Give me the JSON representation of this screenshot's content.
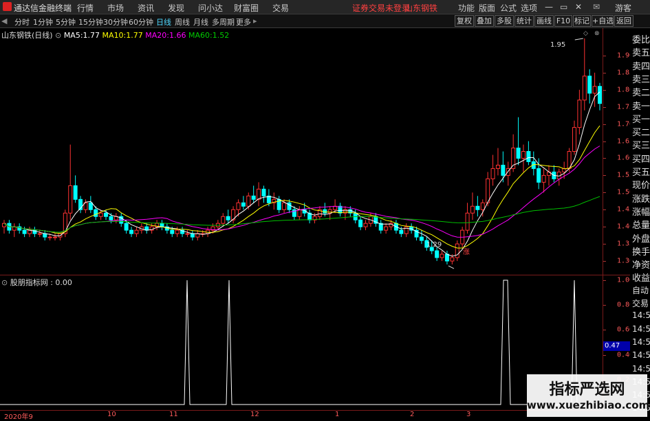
{
  "app": {
    "title": "通达信金融终端",
    "menu": [
      "行情",
      "市场",
      "资讯",
      "发现",
      "问小达",
      "财富圈",
      "交易"
    ],
    "broker_status": "证券交易未登录",
    "stock_title": "山东钢铁",
    "right_menu": [
      "功能",
      "版面",
      "公式",
      "选项"
    ],
    "user": "游客",
    "icon_names": [
      "app-logo-icon",
      "minimize-icon",
      "maximize-icon",
      "close-icon",
      "notification-icon",
      "back-arrow-icon",
      "forward-arrow-icon"
    ]
  },
  "toolbar": {
    "periods": [
      "分时",
      "1分钟",
      "5分钟",
      "15分钟",
      "30分钟",
      "60分钟",
      "日线",
      "周线",
      "月线",
      "多周期",
      "更多"
    ],
    "active": "日线",
    "buttons": [
      "复权",
      "叠加",
      "多股",
      "统计",
      "画线",
      "F10",
      "标记",
      "+自选",
      "返回"
    ]
  },
  "chart": {
    "title": "山东钢铁(日线)",
    "ma": [
      {
        "label": "MA5:",
        "value": "1.77",
        "color": "#ffffff"
      },
      {
        "label": "MA10:",
        "value": "1.77",
        "color": "#ffff00"
      },
      {
        "label": "MA20:",
        "value": "1.66",
        "color": "#ff00ff"
      },
      {
        "label": "MA60:",
        "value": "1.52",
        "color": "#00c000"
      }
    ],
    "high_label": "1.95",
    "low_label": "1.29",
    "zhang_label": "涨",
    "y_ticks": [
      "1.90",
      "1.85",
      "1.80",
      "1.75",
      "1.70",
      "1.65",
      "1.60",
      "1.55",
      "1.50",
      "1.45",
      "1.40",
      "1.35",
      "1.30"
    ]
  },
  "indicator": {
    "title": "股朋指标网 : 0.00",
    "y_ticks": [
      "1.00",
      "0.80",
      "0.60",
      "0.40",
      "0.20"
    ],
    "current": "0.47"
  },
  "xaxis": {
    "labels": [
      "2020年9",
      "10",
      "11",
      "12",
      "1",
      "2",
      "3"
    ]
  },
  "side_panel": {
    "labels": [
      "委比",
      "卖五",
      "卖四",
      "卖三",
      "卖二",
      "卖一",
      "买一",
      "买二",
      "买三",
      "买四",
      "买五",
      "现价",
      "涨跌",
      "涨幅",
      "总量",
      "外盘",
      "换手",
      "净资",
      "收益",
      "自动",
      "交易",
      "14:54",
      "14:54",
      "14:54",
      "14:54",
      "14:54",
      "14:55",
      "14:55",
      "14:55"
    ]
  },
  "watermark": {
    "line1": "指标严选网",
    "line2": "www.xuezhibiao.com"
  },
  "chart_data": {
    "type": "candlestick",
    "title": "山东钢铁(日线)",
    "ylim": [
      1.26,
      1.98
    ],
    "annotations": {
      "high": 1.95,
      "low": 1.29
    },
    "indicator": {
      "name": "股朋指标网",
      "value": 0.0,
      "ylim": [
        0,
        1.0
      ],
      "spike_dates": [
        "11-16",
        "12-01",
        "03-18",
        "03-31"
      ]
    },
    "x_labels": [
      "2020年9",
      "10",
      "11",
      "12",
      "1",
      "2",
      "3"
    ],
    "ohlc": [
      [
        1.4,
        1.42,
        1.38,
        1.41
      ],
      [
        1.41,
        1.42,
        1.38,
        1.39
      ],
      [
        1.39,
        1.41,
        1.37,
        1.4
      ],
      [
        1.4,
        1.41,
        1.38,
        1.39
      ],
      [
        1.39,
        1.4,
        1.37,
        1.38
      ],
      [
        1.38,
        1.4,
        1.37,
        1.39
      ],
      [
        1.39,
        1.4,
        1.37,
        1.38
      ],
      [
        1.38,
        1.39,
        1.37,
        1.38
      ],
      [
        1.38,
        1.39,
        1.36,
        1.37
      ],
      [
        1.37,
        1.38,
        1.36,
        1.37
      ],
      [
        1.37,
        1.38,
        1.36,
        1.37
      ],
      [
        1.37,
        1.38,
        1.36,
        1.38
      ],
      [
        1.38,
        1.45,
        1.37,
        1.44
      ],
      [
        1.44,
        1.64,
        1.42,
        1.52
      ],
      [
        1.52,
        1.55,
        1.47,
        1.48
      ],
      [
        1.48,
        1.49,
        1.44,
        1.45
      ],
      [
        1.45,
        1.48,
        1.44,
        1.47
      ],
      [
        1.47,
        1.49,
        1.44,
        1.45
      ],
      [
        1.45,
        1.46,
        1.42,
        1.43
      ],
      [
        1.43,
        1.45,
        1.42,
        1.44
      ],
      [
        1.44,
        1.45,
        1.42,
        1.43
      ],
      [
        1.43,
        1.44,
        1.41,
        1.42
      ],
      [
        1.42,
        1.44,
        1.41,
        1.43
      ],
      [
        1.43,
        1.44,
        1.4,
        1.41
      ],
      [
        1.41,
        1.42,
        1.38,
        1.39
      ],
      [
        1.39,
        1.4,
        1.37,
        1.38
      ],
      [
        1.38,
        1.4,
        1.37,
        1.39
      ],
      [
        1.39,
        1.41,
        1.38,
        1.4
      ],
      [
        1.4,
        1.41,
        1.38,
        1.39
      ],
      [
        1.39,
        1.41,
        1.38,
        1.4
      ],
      [
        1.4,
        1.42,
        1.39,
        1.41
      ],
      [
        1.41,
        1.42,
        1.39,
        1.4
      ],
      [
        1.4,
        1.41,
        1.38,
        1.39
      ],
      [
        1.39,
        1.4,
        1.37,
        1.38
      ],
      [
        1.38,
        1.4,
        1.37,
        1.39
      ],
      [
        1.39,
        1.4,
        1.37,
        1.38
      ],
      [
        1.38,
        1.39,
        1.37,
        1.38
      ],
      [
        1.38,
        1.39,
        1.36,
        1.37
      ],
      [
        1.37,
        1.39,
        1.36,
        1.38
      ],
      [
        1.38,
        1.39,
        1.37,
        1.38
      ],
      [
        1.38,
        1.4,
        1.37,
        1.39
      ],
      [
        1.39,
        1.41,
        1.38,
        1.4
      ],
      [
        1.4,
        1.42,
        1.39,
        1.41
      ],
      [
        1.41,
        1.44,
        1.4,
        1.43
      ],
      [
        1.43,
        1.45,
        1.41,
        1.42
      ],
      [
        1.42,
        1.46,
        1.41,
        1.45
      ],
      [
        1.45,
        1.48,
        1.43,
        1.47
      ],
      [
        1.47,
        1.49,
        1.45,
        1.46
      ],
      [
        1.46,
        1.5,
        1.45,
        1.49
      ],
      [
        1.49,
        1.52,
        1.47,
        1.48
      ],
      [
        1.48,
        1.53,
        1.46,
        1.51
      ],
      [
        1.51,
        1.52,
        1.47,
        1.49
      ],
      [
        1.49,
        1.51,
        1.46,
        1.47
      ],
      [
        1.47,
        1.5,
        1.45,
        1.48
      ],
      [
        1.48,
        1.49,
        1.44,
        1.45
      ],
      [
        1.45,
        1.48,
        1.44,
        1.47
      ],
      [
        1.47,
        1.48,
        1.44,
        1.45
      ],
      [
        1.45,
        1.46,
        1.42,
        1.43
      ],
      [
        1.43,
        1.46,
        1.42,
        1.45
      ],
      [
        1.45,
        1.47,
        1.43,
        1.44
      ],
      [
        1.44,
        1.45,
        1.41,
        1.42
      ],
      [
        1.42,
        1.44,
        1.41,
        1.43
      ],
      [
        1.43,
        1.46,
        1.42,
        1.45
      ],
      [
        1.45,
        1.47,
        1.43,
        1.44
      ],
      [
        1.44,
        1.46,
        1.42,
        1.45
      ],
      [
        1.45,
        1.48,
        1.44,
        1.46
      ],
      [
        1.46,
        1.47,
        1.43,
        1.44
      ],
      [
        1.44,
        1.46,
        1.42,
        1.45
      ],
      [
        1.45,
        1.46,
        1.43,
        1.44
      ],
      [
        1.44,
        1.45,
        1.41,
        1.42
      ],
      [
        1.42,
        1.43,
        1.39,
        1.4
      ],
      [
        1.4,
        1.42,
        1.39,
        1.41
      ],
      [
        1.41,
        1.44,
        1.4,
        1.43
      ],
      [
        1.43,
        1.44,
        1.4,
        1.41
      ],
      [
        1.41,
        1.42,
        1.38,
        1.39
      ],
      [
        1.39,
        1.41,
        1.38,
        1.4
      ],
      [
        1.4,
        1.42,
        1.39,
        1.41
      ],
      [
        1.41,
        1.42,
        1.38,
        1.39
      ],
      [
        1.39,
        1.4,
        1.37,
        1.38
      ],
      [
        1.38,
        1.41,
        1.37,
        1.4
      ],
      [
        1.4,
        1.41,
        1.38,
        1.39
      ],
      [
        1.39,
        1.4,
        1.36,
        1.37
      ],
      [
        1.37,
        1.39,
        1.35,
        1.36
      ],
      [
        1.36,
        1.37,
        1.33,
        1.34
      ],
      [
        1.34,
        1.36,
        1.32,
        1.33
      ],
      [
        1.33,
        1.34,
        1.3,
        1.31
      ],
      [
        1.31,
        1.33,
        1.3,
        1.32
      ],
      [
        1.32,
        1.33,
        1.29,
        1.3
      ],
      [
        1.3,
        1.32,
        1.29,
        1.31
      ],
      [
        1.31,
        1.36,
        1.3,
        1.35
      ],
      [
        1.35,
        1.4,
        1.34,
        1.39
      ],
      [
        1.39,
        1.47,
        1.38,
        1.44
      ],
      [
        1.44,
        1.5,
        1.42,
        1.46
      ],
      [
        1.46,
        1.49,
        1.43,
        1.45
      ],
      [
        1.45,
        1.48,
        1.43,
        1.47
      ],
      [
        1.47,
        1.56,
        1.46,
        1.54
      ],
      [
        1.54,
        1.61,
        1.52,
        1.57
      ],
      [
        1.57,
        1.63,
        1.55,
        1.58
      ],
      [
        1.58,
        1.62,
        1.53,
        1.55
      ],
      [
        1.55,
        1.59,
        1.52,
        1.57
      ],
      [
        1.57,
        1.67,
        1.56,
        1.63
      ],
      [
        1.63,
        1.72,
        1.58,
        1.6
      ],
      [
        1.6,
        1.64,
        1.56,
        1.62
      ],
      [
        1.62,
        1.65,
        1.58,
        1.59
      ],
      [
        1.59,
        1.62,
        1.55,
        1.57
      ],
      [
        1.57,
        1.6,
        1.51,
        1.53
      ],
      [
        1.53,
        1.57,
        1.5,
        1.55
      ],
      [
        1.55,
        1.58,
        1.52,
        1.56
      ],
      [
        1.56,
        1.58,
        1.53,
        1.54
      ],
      [
        1.54,
        1.57,
        1.52,
        1.56
      ],
      [
        1.56,
        1.59,
        1.54,
        1.57
      ],
      [
        1.57,
        1.63,
        1.56,
        1.62
      ],
      [
        1.62,
        1.71,
        1.61,
        1.69
      ],
      [
        1.69,
        1.8,
        1.67,
        1.77
      ],
      [
        1.77,
        1.95,
        1.74,
        1.84
      ],
      [
        1.84,
        1.86,
        1.76,
        1.79
      ],
      [
        1.79,
        1.85,
        1.75,
        1.81
      ],
      [
        1.81,
        1.82,
        1.74,
        1.76
      ]
    ]
  },
  "colors": {
    "up": "#ff3232",
    "down": "#00ffff",
    "ma5": "#ffffff",
    "ma10": "#ffff00",
    "ma20": "#ff00ff",
    "ma60": "#00c000",
    "axis": "#ff5b5b",
    "grid": "#7a1a1a"
  }
}
